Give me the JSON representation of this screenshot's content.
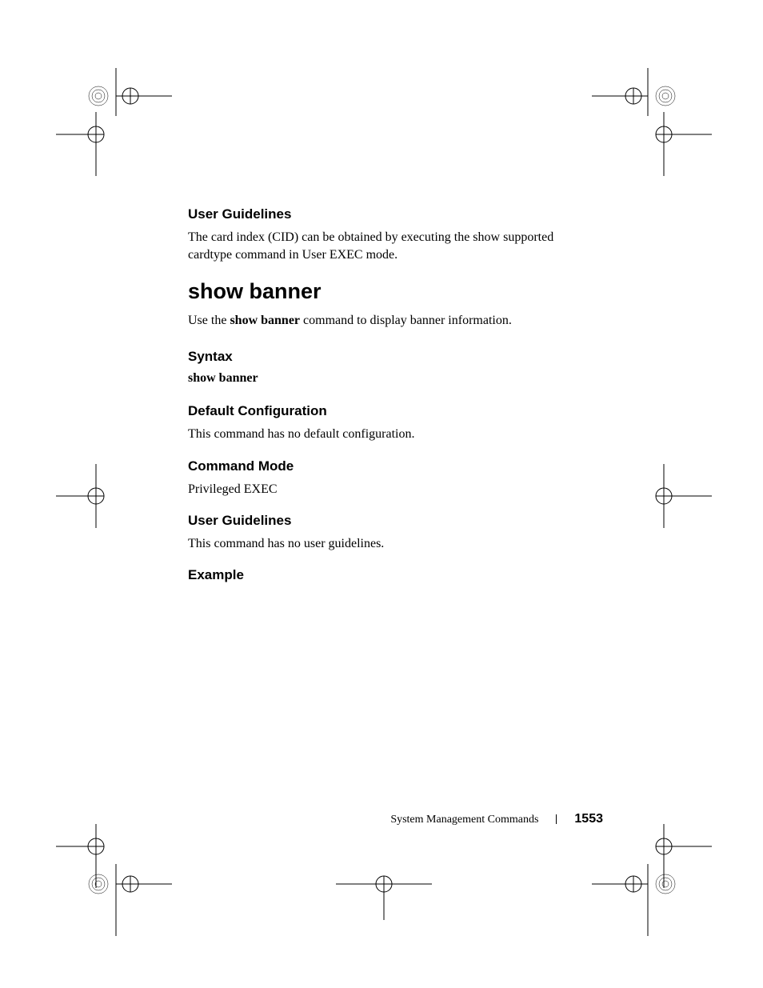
{
  "sections": {
    "userGuidelines1": {
      "heading": "User Guidelines",
      "body": "The card index (CID) can be obtained by executing the show supported cardtype command in User EXEC mode."
    },
    "mainCommand": {
      "heading": "show banner",
      "introPrefix": "Use the ",
      "introBold": "show banner",
      "introSuffix": " command to display banner information."
    },
    "syntax": {
      "heading": "Syntax",
      "body": "show banner"
    },
    "defaultConfig": {
      "heading": "Default Configuration",
      "body": "This command has no default configuration."
    },
    "commandMode": {
      "heading": "Command Mode",
      "body": "Privileged EXEC"
    },
    "userGuidelines2": {
      "heading": "User Guidelines",
      "body": "This command has no user guidelines."
    },
    "example": {
      "heading": "Example"
    }
  },
  "footer": {
    "title": "System Management Commands",
    "page": "1553"
  }
}
